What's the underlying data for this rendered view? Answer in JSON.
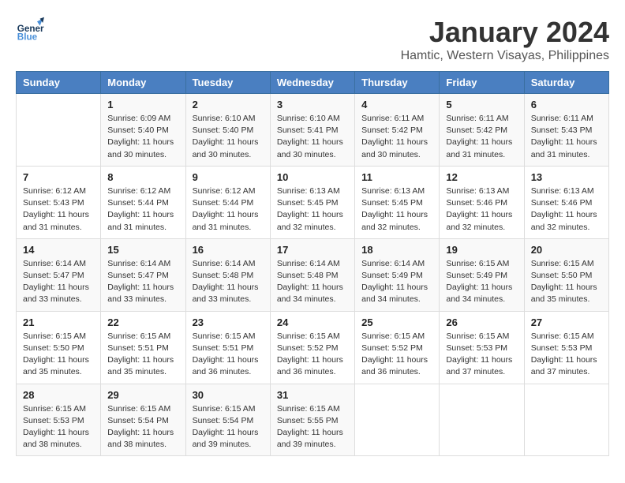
{
  "logo": {
    "line1": "General",
    "line2": "Blue"
  },
  "title": "January 2024",
  "location": "Hamtic, Western Visayas, Philippines",
  "headers": [
    "Sunday",
    "Monday",
    "Tuesday",
    "Wednesday",
    "Thursday",
    "Friday",
    "Saturday"
  ],
  "weeks": [
    [
      {
        "day": "",
        "info": ""
      },
      {
        "day": "1",
        "info": "Sunrise: 6:09 AM\nSunset: 5:40 PM\nDaylight: 11 hours\nand 30 minutes."
      },
      {
        "day": "2",
        "info": "Sunrise: 6:10 AM\nSunset: 5:40 PM\nDaylight: 11 hours\nand 30 minutes."
      },
      {
        "day": "3",
        "info": "Sunrise: 6:10 AM\nSunset: 5:41 PM\nDaylight: 11 hours\nand 30 minutes."
      },
      {
        "day": "4",
        "info": "Sunrise: 6:11 AM\nSunset: 5:42 PM\nDaylight: 11 hours\nand 30 minutes."
      },
      {
        "day": "5",
        "info": "Sunrise: 6:11 AM\nSunset: 5:42 PM\nDaylight: 11 hours\nand 31 minutes."
      },
      {
        "day": "6",
        "info": "Sunrise: 6:11 AM\nSunset: 5:43 PM\nDaylight: 11 hours\nand 31 minutes."
      }
    ],
    [
      {
        "day": "7",
        "info": "Sunrise: 6:12 AM\nSunset: 5:43 PM\nDaylight: 11 hours\nand 31 minutes."
      },
      {
        "day": "8",
        "info": "Sunrise: 6:12 AM\nSunset: 5:44 PM\nDaylight: 11 hours\nand 31 minutes."
      },
      {
        "day": "9",
        "info": "Sunrise: 6:12 AM\nSunset: 5:44 PM\nDaylight: 11 hours\nand 31 minutes."
      },
      {
        "day": "10",
        "info": "Sunrise: 6:13 AM\nSunset: 5:45 PM\nDaylight: 11 hours\nand 32 minutes."
      },
      {
        "day": "11",
        "info": "Sunrise: 6:13 AM\nSunset: 5:45 PM\nDaylight: 11 hours\nand 32 minutes."
      },
      {
        "day": "12",
        "info": "Sunrise: 6:13 AM\nSunset: 5:46 PM\nDaylight: 11 hours\nand 32 minutes."
      },
      {
        "day": "13",
        "info": "Sunrise: 6:13 AM\nSunset: 5:46 PM\nDaylight: 11 hours\nand 32 minutes."
      }
    ],
    [
      {
        "day": "14",
        "info": "Sunrise: 6:14 AM\nSunset: 5:47 PM\nDaylight: 11 hours\nand 33 minutes."
      },
      {
        "day": "15",
        "info": "Sunrise: 6:14 AM\nSunset: 5:47 PM\nDaylight: 11 hours\nand 33 minutes."
      },
      {
        "day": "16",
        "info": "Sunrise: 6:14 AM\nSunset: 5:48 PM\nDaylight: 11 hours\nand 33 minutes."
      },
      {
        "day": "17",
        "info": "Sunrise: 6:14 AM\nSunset: 5:48 PM\nDaylight: 11 hours\nand 34 minutes."
      },
      {
        "day": "18",
        "info": "Sunrise: 6:14 AM\nSunset: 5:49 PM\nDaylight: 11 hours\nand 34 minutes."
      },
      {
        "day": "19",
        "info": "Sunrise: 6:15 AM\nSunset: 5:49 PM\nDaylight: 11 hours\nand 34 minutes."
      },
      {
        "day": "20",
        "info": "Sunrise: 6:15 AM\nSunset: 5:50 PM\nDaylight: 11 hours\nand 35 minutes."
      }
    ],
    [
      {
        "day": "21",
        "info": "Sunrise: 6:15 AM\nSunset: 5:50 PM\nDaylight: 11 hours\nand 35 minutes."
      },
      {
        "day": "22",
        "info": "Sunrise: 6:15 AM\nSunset: 5:51 PM\nDaylight: 11 hours\nand 35 minutes."
      },
      {
        "day": "23",
        "info": "Sunrise: 6:15 AM\nSunset: 5:51 PM\nDaylight: 11 hours\nand 36 minutes."
      },
      {
        "day": "24",
        "info": "Sunrise: 6:15 AM\nSunset: 5:52 PM\nDaylight: 11 hours\nand 36 minutes."
      },
      {
        "day": "25",
        "info": "Sunrise: 6:15 AM\nSunset: 5:52 PM\nDaylight: 11 hours\nand 36 minutes."
      },
      {
        "day": "26",
        "info": "Sunrise: 6:15 AM\nSunset: 5:53 PM\nDaylight: 11 hours\nand 37 minutes."
      },
      {
        "day": "27",
        "info": "Sunrise: 6:15 AM\nSunset: 5:53 PM\nDaylight: 11 hours\nand 37 minutes."
      }
    ],
    [
      {
        "day": "28",
        "info": "Sunrise: 6:15 AM\nSunset: 5:53 PM\nDaylight: 11 hours\nand 38 minutes."
      },
      {
        "day": "29",
        "info": "Sunrise: 6:15 AM\nSunset: 5:54 PM\nDaylight: 11 hours\nand 38 minutes."
      },
      {
        "day": "30",
        "info": "Sunrise: 6:15 AM\nSunset: 5:54 PM\nDaylight: 11 hours\nand 39 minutes."
      },
      {
        "day": "31",
        "info": "Sunrise: 6:15 AM\nSunset: 5:55 PM\nDaylight: 11 hours\nand 39 minutes."
      },
      {
        "day": "",
        "info": ""
      },
      {
        "day": "",
        "info": ""
      },
      {
        "day": "",
        "info": ""
      }
    ]
  ]
}
